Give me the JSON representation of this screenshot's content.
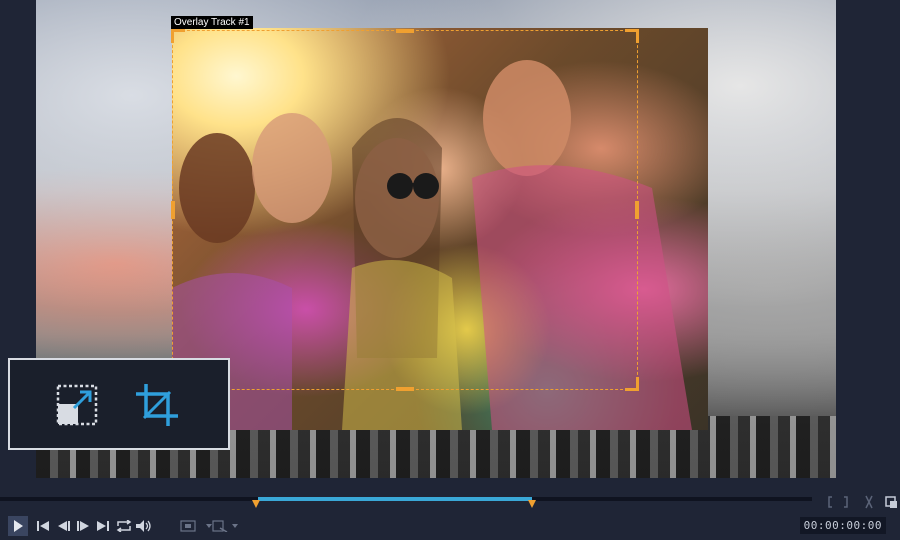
{
  "overlay": {
    "track_label": "Overlay Track #1"
  },
  "tools": {
    "resize_icon": "resize-icon",
    "crop_icon": "crop-icon"
  },
  "playback": {
    "timecode": "00:00:00:00",
    "controls": [
      "play-icon",
      "skip-start-icon",
      "prev-frame-icon",
      "next-frame-icon",
      "skip-end-icon",
      "repeat-icon",
      "volume-icon"
    ]
  },
  "colors": {
    "accent": "#f0a030",
    "timeline_range": "#3aa8d8",
    "tool_icon": "#2f9fdc",
    "panel_bg": "#1f2536"
  }
}
